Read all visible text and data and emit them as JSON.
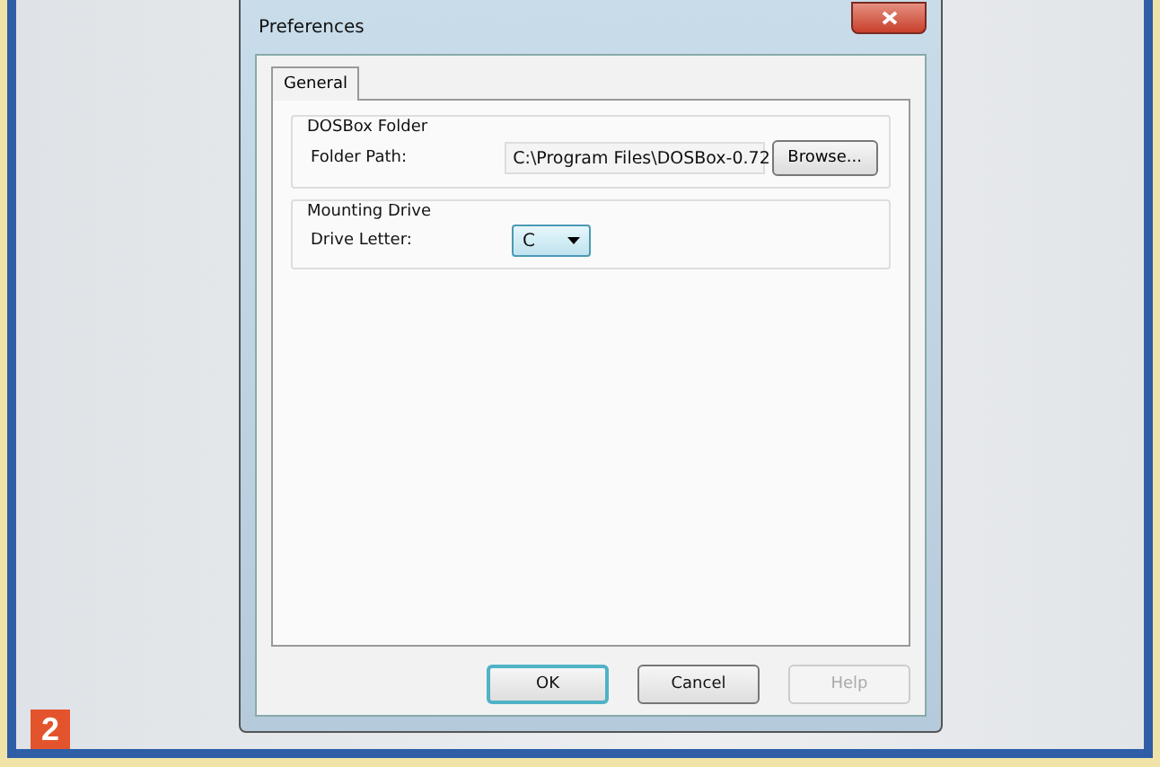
{
  "figure_badge": "2",
  "window": {
    "title": "Preferences"
  },
  "tabs": [
    {
      "label": "General",
      "selected": true
    }
  ],
  "groups": [
    {
      "title": "DOSBox Folder",
      "label": "Folder Path:",
      "kind": "path",
      "value": "C:\\Program Files\\DOSBox-0.72",
      "button": "Browse..."
    },
    {
      "title": "Mounting Drive",
      "label": "Drive Letter:",
      "kind": "dropdown",
      "value": "C"
    }
  ],
  "buttons": [
    {
      "label": "OK",
      "default": true,
      "disabled": false
    },
    {
      "label": "Cancel",
      "default": false,
      "disabled": false
    },
    {
      "label": "Help",
      "default": false,
      "disabled": true
    }
  ]
}
